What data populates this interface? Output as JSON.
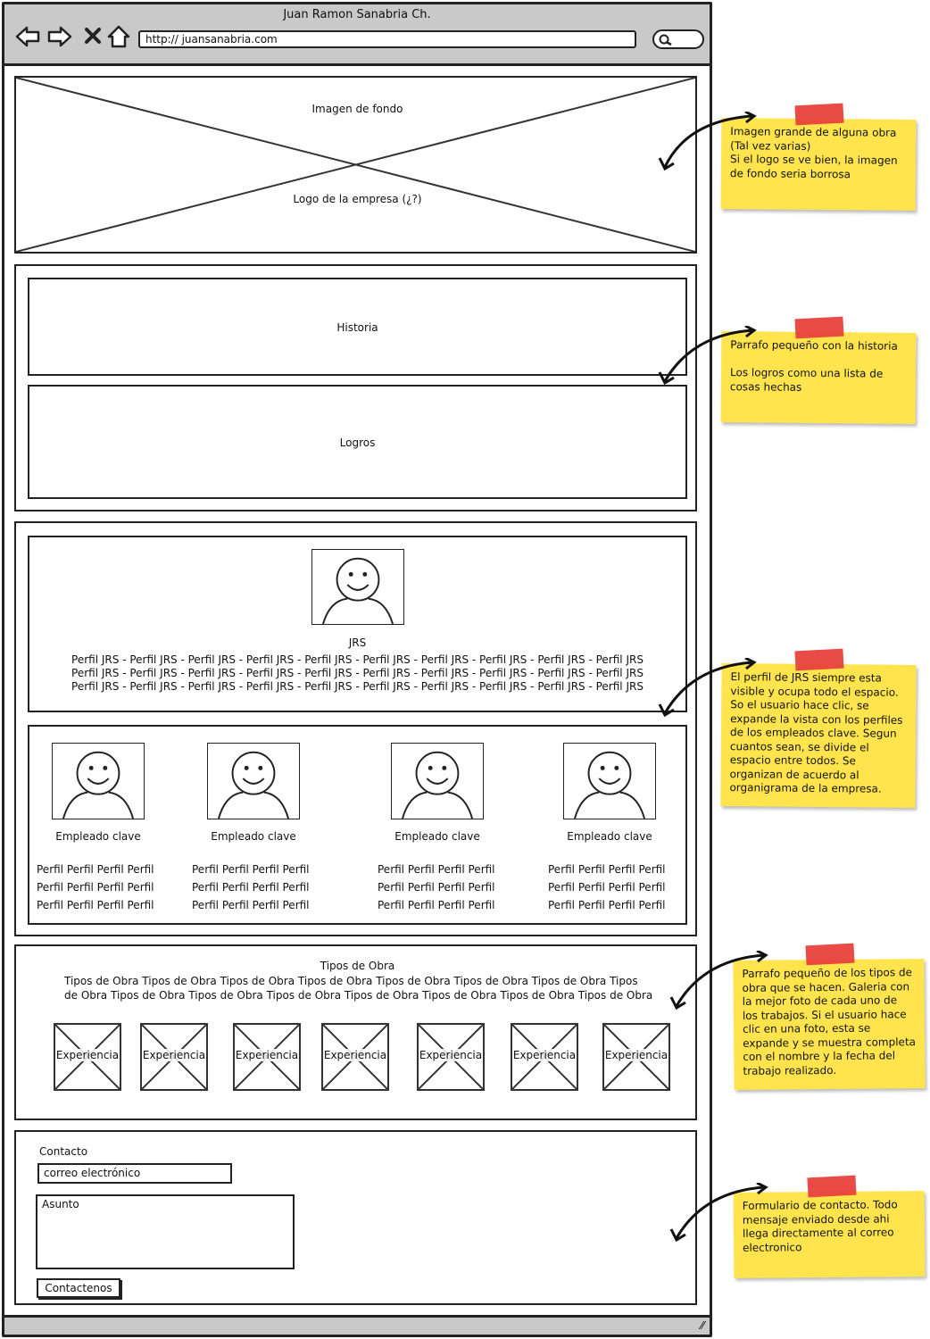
{
  "window": {
    "title": "Juan Ramon Sanabria Ch.",
    "url": "http:// juansanabria.com"
  },
  "hero": {
    "background_label": "Imagen de fondo",
    "logo_label": "Logo de la empresa (¿?)"
  },
  "about": {
    "history_label": "Historia",
    "achievements_label": "Logros"
  },
  "team": {
    "main_name": "JRS",
    "main_profile_lines": [
      "Perfil JRS - Perfil JRS - Perfil JRS - Perfil JRS - Perfil JRS - Perfil JRS - Perfil JRS - Perfil JRS - Perfil JRS - Perfil JRS",
      "Perfil JRS - Perfil JRS - Perfil JRS - Perfil JRS - Perfil JRS - Perfil JRS - Perfil JRS - Perfil JRS - Perfil JRS - Perfil JRS",
      "Perfil JRS - Perfil JRS - Perfil JRS - Perfil JRS - Perfil JRS - Perfil JRS - Perfil JRS - Perfil JRS - Perfil JRS - Perfil JRS"
    ],
    "employees": [
      {
        "name": "Empleado clave",
        "lines": [
          "Perfil Perfil Perfil Perfil",
          "Perfil Perfil Perfil Perfil",
          "Perfil Perfil Perfil Perfil"
        ]
      },
      {
        "name": "Empleado clave",
        "lines": [
          "Perfil Perfil Perfil Perfil",
          "Perfil Perfil Perfil Perfil",
          "Perfil Perfil Perfil Perfil"
        ]
      },
      {
        "name": "Empleado clave",
        "lines": [
          "Perfil Perfil Perfil Perfil",
          "Perfil Perfil Perfil Perfil",
          "Perfil Perfil Perfil Perfil"
        ]
      },
      {
        "name": "Empleado clave",
        "lines": [
          "Perfil Perfil Perfil Perfil",
          "Perfil Perfil Perfil Perfil",
          "Perfil Perfil Perfil Perfil"
        ]
      }
    ]
  },
  "works": {
    "title": "Tipos de Obra",
    "description_lines": [
      "Tipos de Obra Tipos de Obra Tipos de Obra Tipos de Obra Tipos de Obra Tipos de Obra Tipos de Obra Tipos",
      "de Obra Tipos de Obra Tipos de Obra Tipos de Obra Tipos de Obra Tipos de Obra Tipos de Obra Tipos de Obra"
    ],
    "thumb_caption": "Experiencia"
  },
  "contact": {
    "title": "Contacto",
    "email_value": "correo electrónico",
    "subject_value": "Asunto",
    "submit_label": "Contactenos"
  },
  "notes": [
    {
      "text": "Imagen grande de alguna obra (Tal vez varias)\nSi el logo se ve bien, la imagen de fondo seria borrosa"
    },
    {
      "text": "Parrafo pequeño con la historia\n\nLos logros como una lista de cosas hechas"
    },
    {
      "text": "El perfil de JRS siempre esta visible y ocupa todo el espacio. So el usuario hace clic, se expande la vista con los perfiles de los empleados clave. Segun cuantos sean, se divide el espacio entre todos. Se organizan de acuerdo al organigrama de la empresa."
    },
    {
      "text": "Parrafo pequeño de los tipos de obra que se hacen. Galeria con la mejor foto de cada uno de los trabajos. Si el usuario hace clic en una foto, esta se expande y se muestra completa con el nombre y la fecha del trabajo realizado."
    },
    {
      "text": "Formulario de contacto. Todo mensaje enviado desde ahi llega directamente al correo electronico"
    }
  ],
  "colors": {
    "note": "#ffe44d",
    "tape": "#e8413c",
    "chrome": "#c9c9c9"
  }
}
